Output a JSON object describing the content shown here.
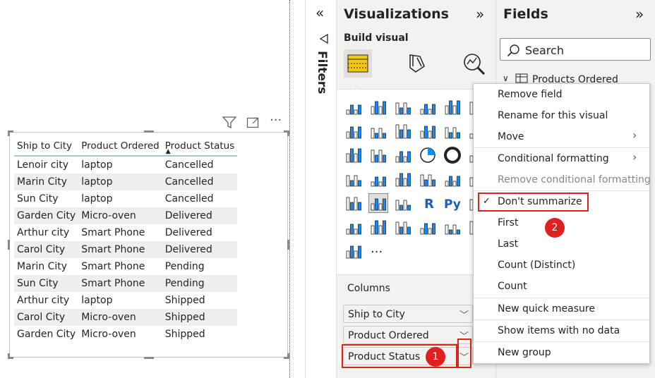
{
  "table": {
    "headers": [
      "Ship to City",
      "Product Ordered",
      "Product Status"
    ],
    "rows": [
      [
        "Lenoir city",
        "laptop",
        "Cancelled"
      ],
      [
        "Marin City",
        "laptop",
        "Cancelled"
      ],
      [
        "Sun City",
        "laptop",
        "Cancelled"
      ],
      [
        "Garden City",
        "Micro-oven",
        "Delivered"
      ],
      [
        "Arthur city",
        "Smart Phone",
        "Delivered"
      ],
      [
        "Carol City",
        "Smart Phone",
        "Delivered"
      ],
      [
        "Marin City",
        "Smart Phone",
        "Pending"
      ],
      [
        "Sun City",
        "Smart Phone",
        "Pending"
      ],
      [
        "Arthur city",
        "laptop",
        "Shipped"
      ],
      [
        "Carol City",
        "Micro-oven",
        "Shipped"
      ],
      [
        "Garden City",
        "Micro-oven",
        "Shipped"
      ]
    ]
  },
  "filters": {
    "label": "Filters"
  },
  "visualizations": {
    "title": "Visualizations",
    "build_visual": "Build visual",
    "columns_label": "Columns",
    "wells": [
      "Ship to City",
      "Product Ordered",
      "Product Status"
    ],
    "more": "···"
  },
  "fields": {
    "title": "Fields",
    "search_placeholder": "Search",
    "table_name": "Products Ordered"
  },
  "menu": {
    "items": {
      "remove_field": "Remove field",
      "rename": "Rename for this visual",
      "move": "Move",
      "conditional_formatting": "Conditional formatting",
      "remove_conditional": "Remove conditional formatting",
      "dont_summarize": "Don't summarize",
      "first": "First",
      "last": "Last",
      "count_distinct": "Count (Distinct)",
      "count": "Count",
      "new_quick_measure": "New quick measure",
      "show_items": "Show items with no data",
      "new_group": "New group"
    }
  },
  "badges": {
    "one": "1",
    "two": "2"
  },
  "colors": {
    "accent_red": "#d9261c",
    "badge_red": "#e02020",
    "highlight_yellow": "#f2c811"
  }
}
